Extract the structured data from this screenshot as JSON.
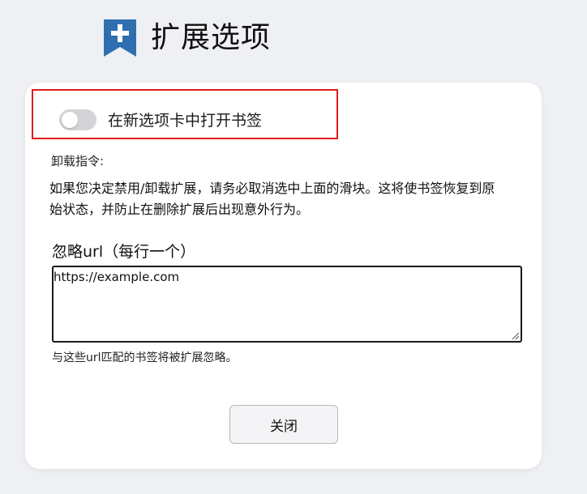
{
  "header": {
    "title": "扩展选项",
    "logo_icon": "bookmark-plus-icon",
    "logo_color": "#2f6fb0"
  },
  "options": {
    "open_in_new_tab": {
      "label": "在新选项卡中打开书签",
      "enabled": false
    },
    "highlight_color": "#e01b1b"
  },
  "uninstall": {
    "title": "卸载指令:",
    "text": "如果您决定禁用/卸载扩展，请务必取消选中上面的滑块。这将使书签恢复到原始状态，并防止在删除扩展后出现意外行为。"
  },
  "ignore": {
    "title": "忽略url（每行一个）",
    "value": "https://example.com",
    "hint": "与这些url匹配的书签将被扩展忽略。"
  },
  "footer": {
    "close_label": "关闭"
  }
}
